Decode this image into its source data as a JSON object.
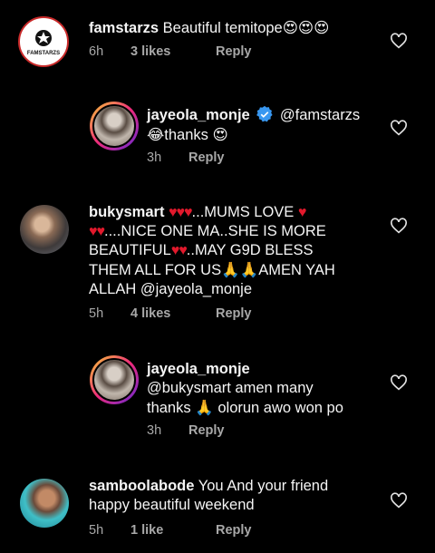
{
  "comments": [
    {
      "username": "famstarzs",
      "text": "Beautiful temitope",
      "emoji": "😍😍😍",
      "time": "6h",
      "likes": "3 likes",
      "reply": "Reply",
      "avatar_text": "FAMSTARZS"
    },
    {
      "username": "jayeola_monje",
      "mention": "@famstarzs",
      "text_line2_emoji": "😂",
      "text_line2": "thanks",
      "text_line2_emoji_end": "😍",
      "time": "3h",
      "reply": "Reply"
    },
    {
      "username": "bukysmart",
      "line1": "...MUMS LOVE",
      "line2": "....NICE ONE MA..SHE IS MORE",
      "line3a": "BEAUTIFUL",
      "line3b": "..MAY G9D BLESS",
      "line4a": "THEM ALL FOR US",
      "line4b": "AMEN YAH",
      "line5": "ALLAH @jayeola_monje",
      "time": "5h",
      "likes": "4 likes",
      "reply": "Reply"
    },
    {
      "username": "jayeola_monje",
      "line1": "amen many",
      "line2": "@bukysmart amen many",
      "line3a": "thanks",
      "line3b": "olorun awo won po",
      "time": "3h",
      "reply": "Reply"
    },
    {
      "username": "samboolabode",
      "line1": "You And your friend",
      "line2": "happy beautiful weekend",
      "time": "5h",
      "likes": "1 like",
      "reply": "Reply"
    }
  ],
  "colors": {
    "background": "#000000",
    "text": "#f5f5f5",
    "meta": "#a8a8a8",
    "verified": "#3897f0",
    "heart": "#e2192c"
  }
}
